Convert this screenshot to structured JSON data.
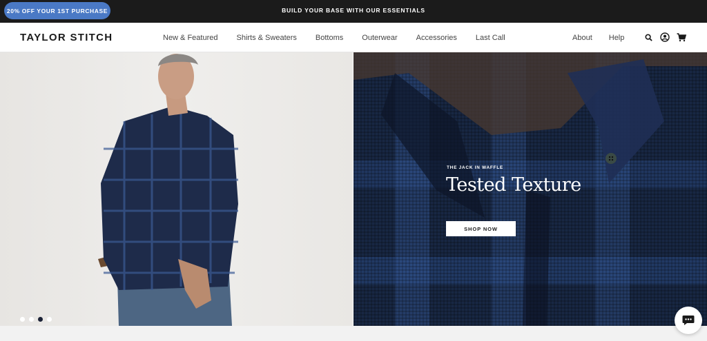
{
  "announcement": {
    "promo_label": "20% OFF YOUR 1ST PURCHASE",
    "message": "BUILD YOUR BASE WITH OUR ESSENTIALS",
    "colors": {
      "bar": "#1b1b1b",
      "pill": "#4a79c5"
    }
  },
  "header": {
    "logo": "TAYLOR STITCH",
    "nav": [
      {
        "label": "New & Featured"
      },
      {
        "label": "Shirts & Sweaters"
      },
      {
        "label": "Bottoms"
      },
      {
        "label": "Outerwear"
      },
      {
        "label": "Accessories"
      },
      {
        "label": "Last Call"
      }
    ],
    "utility": [
      {
        "label": "About"
      },
      {
        "label": "Help"
      }
    ],
    "icons": [
      "search-icon",
      "account-icon",
      "cart-icon"
    ]
  },
  "hero": {
    "eyebrow": "THE JACK IN WAFFLE",
    "headline": "Tested Texture",
    "cta": "SHOP NOW",
    "slides": {
      "count": 4,
      "active": 3
    },
    "colors": {
      "fabric_navy": "#182743"
    }
  },
  "chat": {
    "icon": "chat-icon"
  }
}
